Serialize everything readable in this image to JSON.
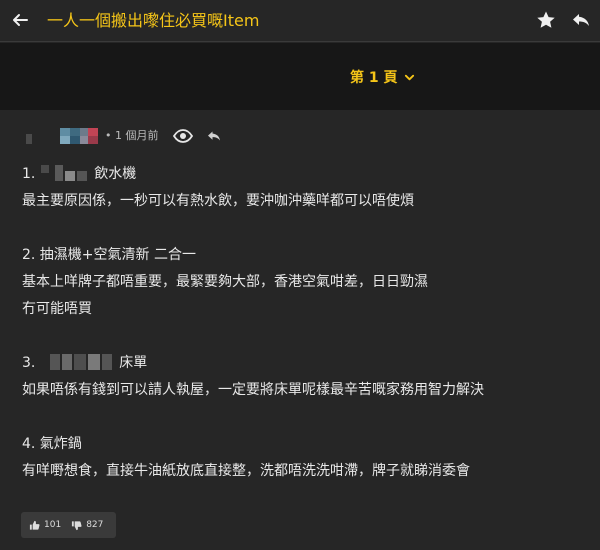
{
  "header": {
    "back_icon": "arrow-left-icon",
    "title": "一人一個搬出嚟住必買嘅Item",
    "star_icon": "star-icon",
    "reply_icon": "reply-icon"
  },
  "pagination": {
    "label": "第 1 頁",
    "icon": "chevron-down-icon"
  },
  "post": {
    "time": "• 1 個月前",
    "views_icon": "eye-icon",
    "quote_icon": "reply-icon",
    "lines": {
      "l1_prefix": "1.",
      "l1_suffix": "飲水機",
      "l2": "最主要原因係，一秒可以有熱水飲，要沖咖沖藥咩都可以唔使煩",
      "l3": "2. 抽濕機+空氣清新 二合一",
      "l4": "基本上咩牌子都唔重要，最緊要夠大部，香港空氣咁差，日日勁濕",
      "l5": "冇可能唔買",
      "l6_prefix": "3.",
      "l6_suffix": "床單",
      "l7": "如果唔係有錢到可以請人執屋，一定要將床單呢樣最辛苦嘅家務用智力解決",
      "l8": "4. 氣炸鍋",
      "l9": "有咩嘢想食，直接牛油紙放底直接整，洗都唔洗洗咁滯，牌子就睇消委會"
    },
    "votes": {
      "up_icon": "thumbs-up-icon",
      "up_count": "101",
      "down_icon": "thumbs-down-icon",
      "down_count": "827"
    }
  },
  "colors": {
    "accent": "#f5c518",
    "background": "#262626",
    "pagebar": "#171717"
  }
}
